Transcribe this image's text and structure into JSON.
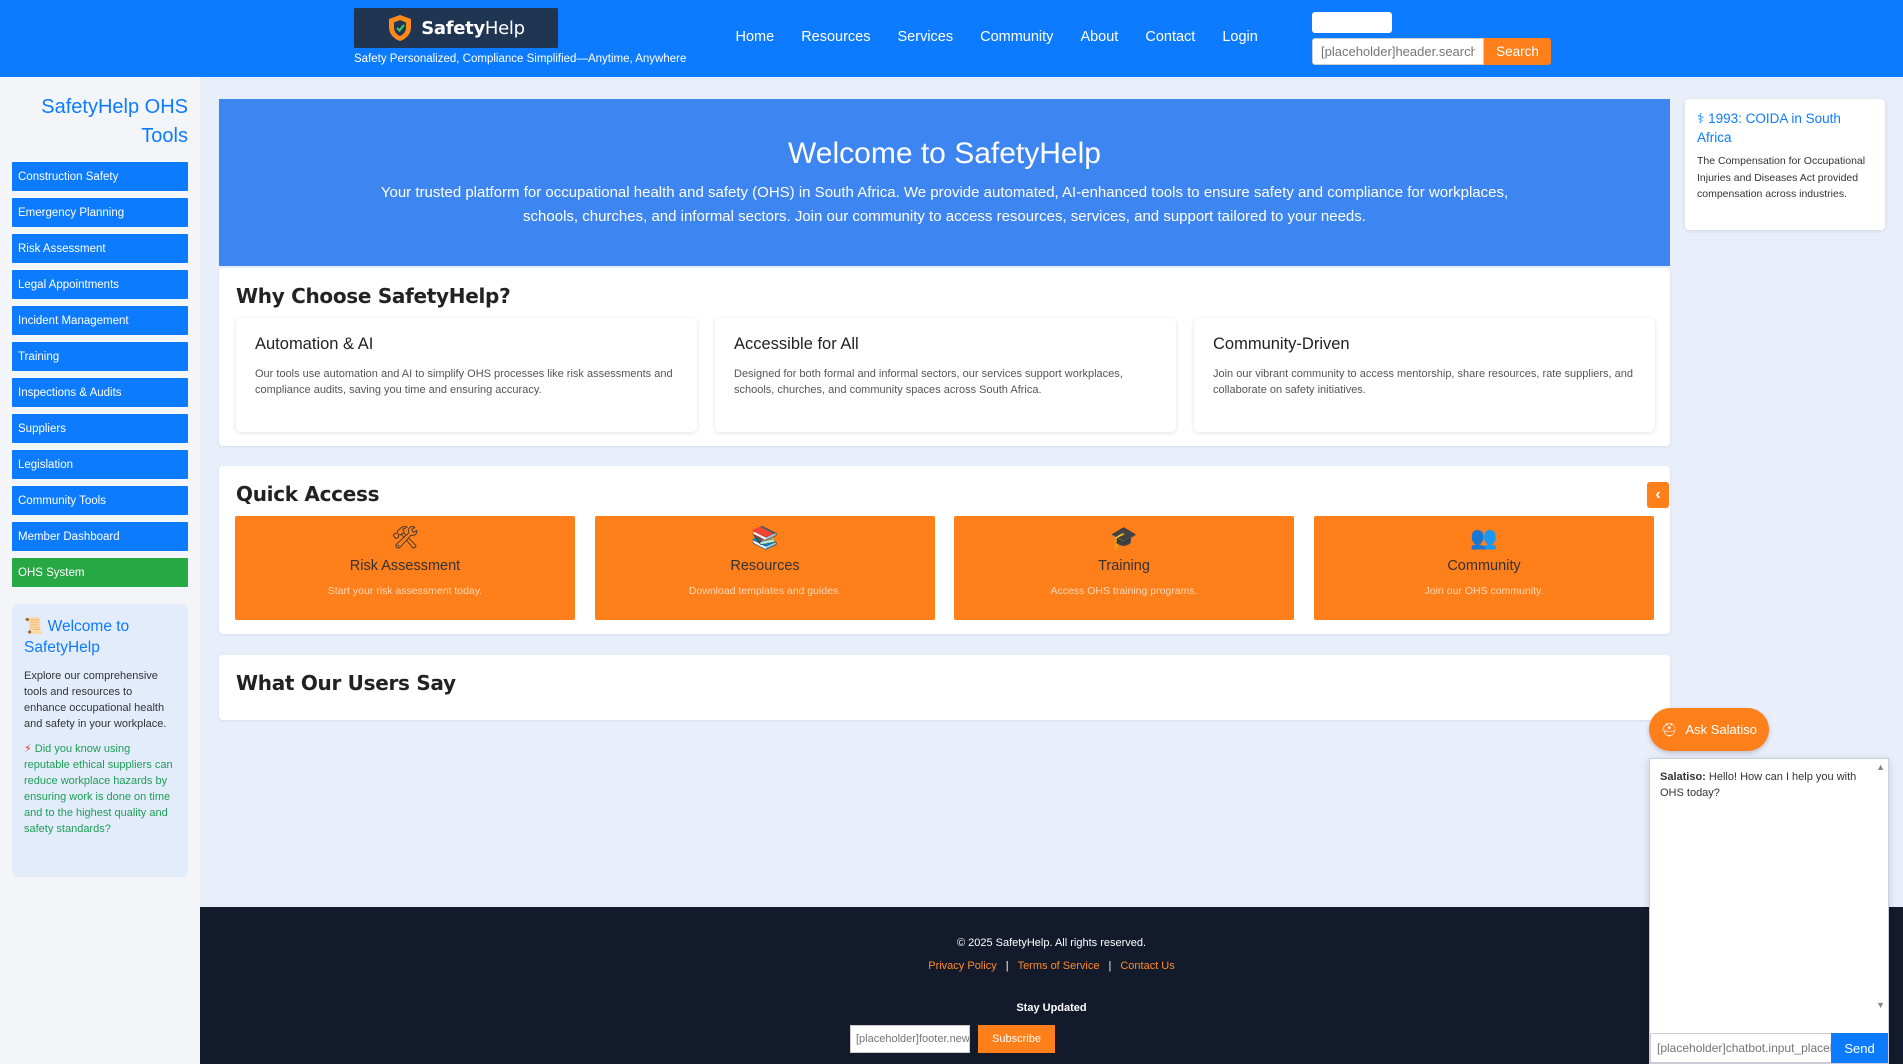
{
  "header": {
    "logo_text_bold": "Safety",
    "logo_text_light": "Help",
    "tagline": "Safety Personalized, Compliance Simplified—Anytime, Anywhere",
    "nav": [
      "Home",
      "Resources",
      "Services",
      "Community",
      "About",
      "Contact",
      "Login"
    ],
    "search_placeholder": "[placeholder]header.search",
    "search_button": "Search"
  },
  "sidebar": {
    "title": "SafetyHelp OHS Tools",
    "items": [
      "Construction Safety",
      "Emergency Planning",
      "Risk Assessment",
      "Legal Appointments",
      "Incident Management",
      "Training",
      "Inspections & Audits",
      "Suppliers",
      "Legislation",
      "Community Tools",
      "Member Dashboard",
      "OHS System"
    ],
    "welcome_icon": "📜",
    "welcome_title": "Welcome to SafetyHelp",
    "welcome_desc": "Explore our comprehensive tools and resources to enhance occupational health and safety in your workplace.",
    "tip_icon": "⚡",
    "tip": "Did you know using reputable ethical suppliers can reduce workplace hazards by ensuring work is done on time and to the highest quality and safety standards?"
  },
  "hero": {
    "title": "Welcome to SafetyHelp",
    "text": "Your trusted platform for occupational health and safety (OHS) in South Africa. We provide automated, AI-enhanced tools to ensure safety and compliance for workplaces, schools, churches, and informal sectors. Join our community to access resources, services, and support tailored to your needs."
  },
  "why": {
    "title": "Why Choose SafetyHelp?",
    "cards": [
      {
        "title": "Automation & AI",
        "desc": "Our tools use automation and AI to simplify OHS processes like risk assessments and compliance audits, saving you time and ensuring accuracy."
      },
      {
        "title": "Accessible for All",
        "desc": "Designed for both formal and informal sectors, our services support workplaces, schools, churches, and community spaces across South Africa."
      },
      {
        "title": "Community-Driven",
        "desc": "Join our vibrant community to access mentorship, share resources, rate suppliers, and collaborate on safety initiatives."
      }
    ]
  },
  "quick": {
    "title": "Quick Access",
    "prev_label": "‹",
    "cards": [
      {
        "icon": "🛠",
        "title": "Risk Assessment",
        "sub": "Start your risk assessment today."
      },
      {
        "icon": "📚",
        "title": "Resources",
        "sub": "Download templates and guides."
      },
      {
        "icon": "🎓",
        "title": "Training",
        "sub": "Access OHS training programs."
      },
      {
        "icon": "👥",
        "title": "Community",
        "sub": "Join our OHS community."
      }
    ]
  },
  "testimonials": {
    "title": "What Our Users Say"
  },
  "fact": {
    "icon": "⚕",
    "title": "1993: COIDA in South Africa",
    "desc": "The Compensation for Occupational Injuries and Diseases Act provided compensation across industries."
  },
  "footer": {
    "copyright": "© 2025 SafetyHelp. All rights reserved.",
    "links": [
      "Privacy Policy",
      "Terms of Service",
      "Contact Us"
    ],
    "stay_updated": "Stay Updated",
    "email_placeholder": "[placeholder]footer.newsletter",
    "subscribe": "Subscribe"
  },
  "chatbot": {
    "toggle_icon": "⛑",
    "toggle_label": "Ask Salatiso",
    "sender": "Salatiso:",
    "message": " Hello! How can I help you with OHS today?",
    "input_placeholder": "[placeholder]chatbot.input_placeholder",
    "send": "Send"
  },
  "colors": {
    "primary": "#0d7bff",
    "accent": "#ff7f1a",
    "hero": "#3d86f2",
    "footer": "#121a2b",
    "success": "#28a745"
  }
}
